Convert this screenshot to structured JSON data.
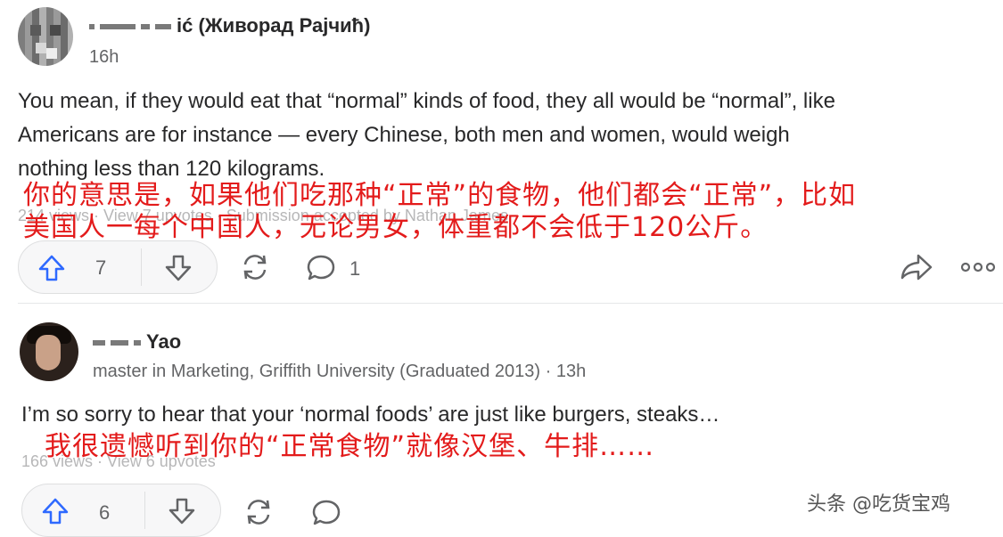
{
  "post1": {
    "author_suffix": "ić (Живорад Рајчић)",
    "time": "16h",
    "body_lines": [
      "You mean, if they would eat that “normal” kinds of food, they all would be “normal”, like",
      "Americans are for instance — every Chinese, both men and women, would weigh",
      "nothing less than 120 kilograms."
    ],
    "stats": "214 views · View 7 upvotes · Submission accepted by Nathan James",
    "translation_lines": [
      "你的意思是，如果他们吃那种“正常”的食物，他们都会“正常”，比如",
      "美国人一每个中国人，无论男女，体重都不会低于120公斤。"
    ],
    "upvotes": "7",
    "comments": "1"
  },
  "post2": {
    "author_suffix": "Yao",
    "credential": "master in Marketing, Griffith University (Graduated 2013) · 13h",
    "body": "I’m so sorry to hear that your ‘normal foods’ are just like burgers, steaks…",
    "stats": "166 views · View 6 upvotes",
    "translation": "我很遗憾听到你的“正常食物”就像汉堡、牛排……",
    "upvotes": "6"
  },
  "watermark": "头条 @吃货宝鸡",
  "colors": {
    "accent_blue": "#2e69ff",
    "translation_red": "#e31b1b"
  }
}
